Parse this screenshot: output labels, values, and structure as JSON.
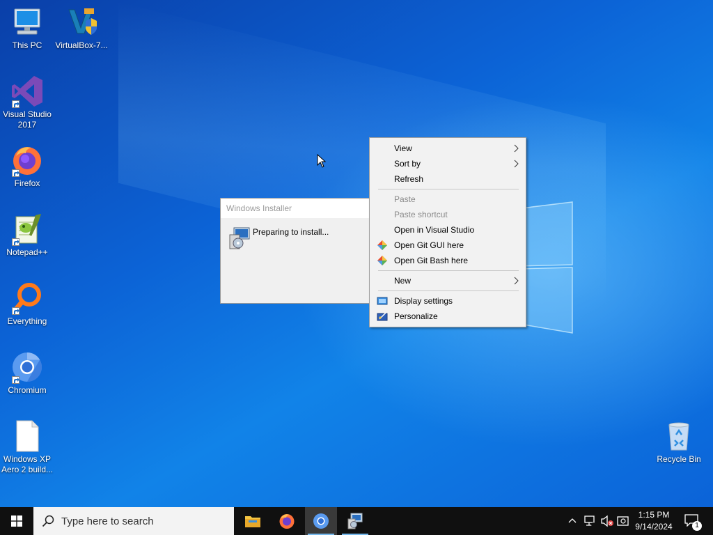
{
  "desktop": {
    "icons": [
      {
        "label": "This PC",
        "icon": "computer-icon"
      },
      {
        "label": "VirtualBox-7...",
        "icon": "virtualbox-installer-icon"
      },
      {
        "label": "Visual Studio 2017",
        "icon": "visual-studio-icon"
      },
      {
        "label": "Firefox",
        "icon": "firefox-icon"
      },
      {
        "label": "Notepad++",
        "icon": "notepadpp-icon"
      },
      {
        "label": "Everything",
        "icon": "everything-icon"
      },
      {
        "label": "Chromium",
        "icon": "chromium-icon"
      },
      {
        "label": "Windows XP Aero 2 build...",
        "icon": "document-icon"
      },
      {
        "label": "Recycle Bin",
        "icon": "recycle-bin-icon"
      }
    ]
  },
  "installer": {
    "title": "Windows Installer",
    "status": "Preparing to install..."
  },
  "context_menu": {
    "items": [
      {
        "label": "View",
        "submenu": true,
        "enabled": true
      },
      {
        "label": "Sort by",
        "submenu": true,
        "enabled": true
      },
      {
        "label": "Refresh",
        "enabled": true
      },
      {
        "label": "Paste",
        "enabled": false
      },
      {
        "label": "Paste shortcut",
        "enabled": false
      },
      {
        "label": "Open in Visual Studio",
        "enabled": true
      },
      {
        "label": "Open Git GUI here",
        "icon": "git-icon",
        "enabled": true
      },
      {
        "label": "Open Git Bash here",
        "icon": "git-icon",
        "enabled": true
      },
      {
        "label": "New",
        "submenu": true,
        "enabled": true
      },
      {
        "label": "Display settings",
        "icon": "display-icon",
        "enabled": true
      },
      {
        "label": "Personalize",
        "icon": "personalize-icon",
        "enabled": true
      }
    ]
  },
  "taskbar": {
    "search_placeholder": "Type here to search",
    "apps": [
      "file-explorer-icon",
      "firefox-icon",
      "chromium-icon",
      "installer-icon"
    ],
    "active_app": "chromium-icon",
    "clock": {
      "time": "1:15 PM",
      "date": "9/14/2024"
    },
    "notification_count": "1"
  },
  "colors": {
    "desktop_blue": "#0c63d6",
    "taskbar": "#101010",
    "menu_bg": "#f2f2f2",
    "disabled_text": "#8a8a8a"
  }
}
